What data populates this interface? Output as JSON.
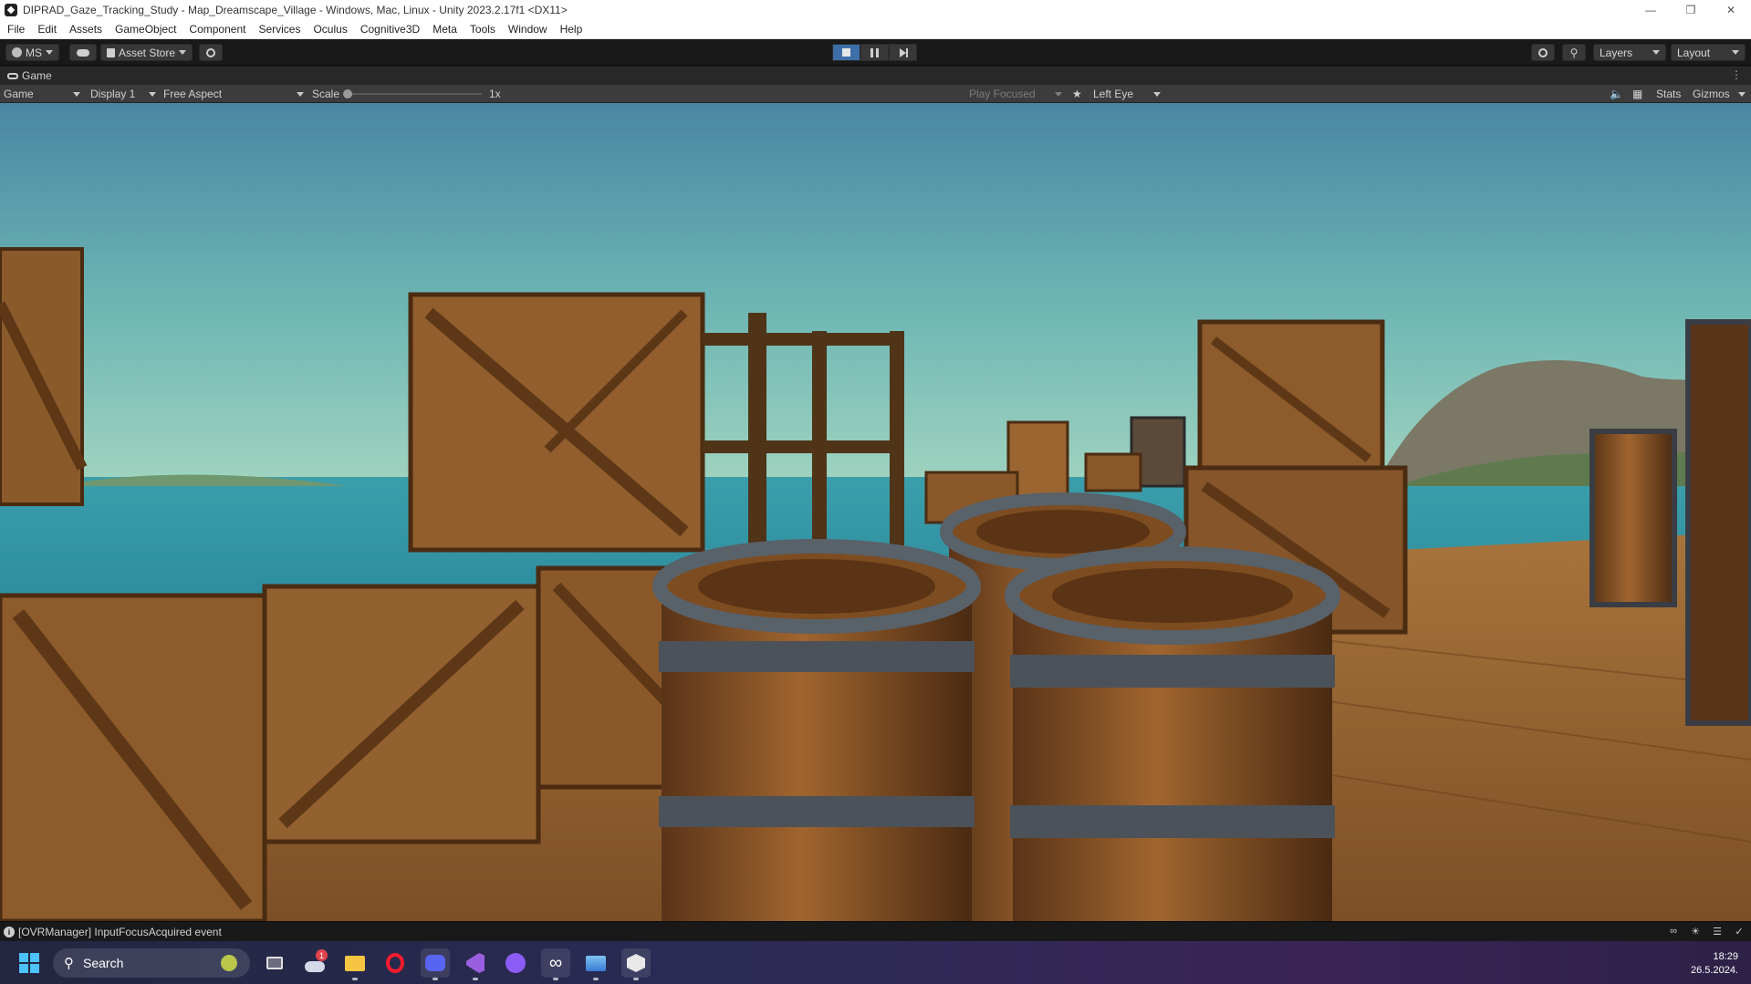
{
  "window": {
    "title": "DIPRAD_Gaze_Tracking_Study - Map_Dreamscape_Village - Windows, Mac, Linux - Unity 2023.2.17f1 <DX11>"
  },
  "menu": [
    "File",
    "Edit",
    "Assets",
    "GameObject",
    "Component",
    "Services",
    "Oculus",
    "Cognitive3D",
    "Meta",
    "Tools",
    "Window",
    "Help"
  ],
  "toolbar": {
    "account": "MS",
    "asset_store": "Asset Store",
    "layers": "Layers",
    "layout": "Layout"
  },
  "game_tab": {
    "label": "Game"
  },
  "game_toolbar": {
    "view": "Game",
    "display": "Display 1",
    "aspect": "Free Aspect",
    "scale_label": "Scale",
    "scale_value": "1x",
    "play_mode": "Play Focused",
    "eye": "Left Eye",
    "stats": "Stats",
    "gizmos": "Gizmos"
  },
  "status": {
    "message": "[OVRManager] InputFocusAcquired event"
  },
  "taskbar": {
    "search_placeholder": "Search",
    "weather_badge": "1",
    "time": "18:29",
    "date": "26.5.2024."
  },
  "colors": {
    "unity_dark": "#191919",
    "play_active": "#3d6ea8",
    "sky_top": "#4a8aa4",
    "sea": "#3a9aa6",
    "wood": "#8a5a2e"
  }
}
